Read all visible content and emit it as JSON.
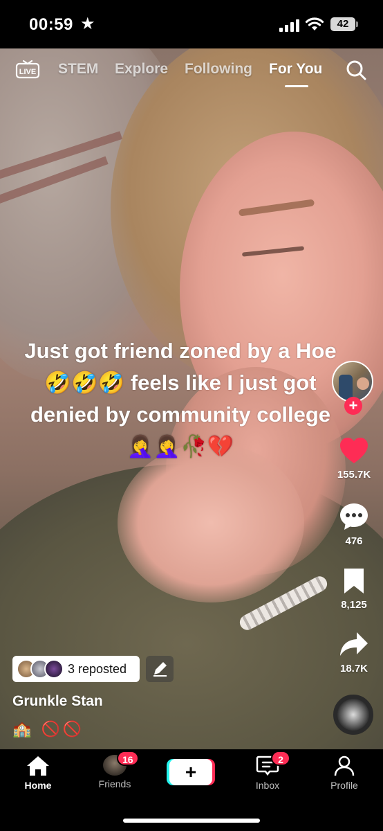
{
  "status_bar": {
    "time": "00:59",
    "battery": "42"
  },
  "top_nav": {
    "live_label": "LIVE",
    "tabs": [
      {
        "label": "STEM"
      },
      {
        "label": "Explore"
      },
      {
        "label": "Following"
      },
      {
        "label": "For You",
        "active": true
      }
    ]
  },
  "video": {
    "caption": "Just got friend zoned by a Hoe 🤣🤣🤣 feels like I just got denied by community college 🤦‍♀️🤦‍♀️🥀💔"
  },
  "rail": {
    "likes": "155.7K",
    "comments": "476",
    "saves": "8,125",
    "shares": "18.7K"
  },
  "post": {
    "repost_text": "3 reposted",
    "author": "Grunkle Stan",
    "description": "🏫 🚫🚫"
  },
  "bottom_nav": {
    "items": [
      {
        "label": "Home",
        "active": true
      },
      {
        "label": "Friends",
        "badge": "16"
      },
      {
        "label": "Inbox",
        "badge": "2"
      },
      {
        "label": "Profile"
      }
    ]
  },
  "colors": {
    "accent": "#fe2c55",
    "cyan": "#25f4ee",
    "background": "#000000"
  },
  "icons": [
    "star-icon",
    "signal-icon",
    "wifi-icon",
    "battery-icon",
    "live-icon",
    "search-icon",
    "heart-icon",
    "comment-icon",
    "bookmark-icon",
    "share-icon",
    "pencil-icon",
    "home-icon",
    "inbox-icon",
    "profile-icon",
    "plus-icon"
  ]
}
